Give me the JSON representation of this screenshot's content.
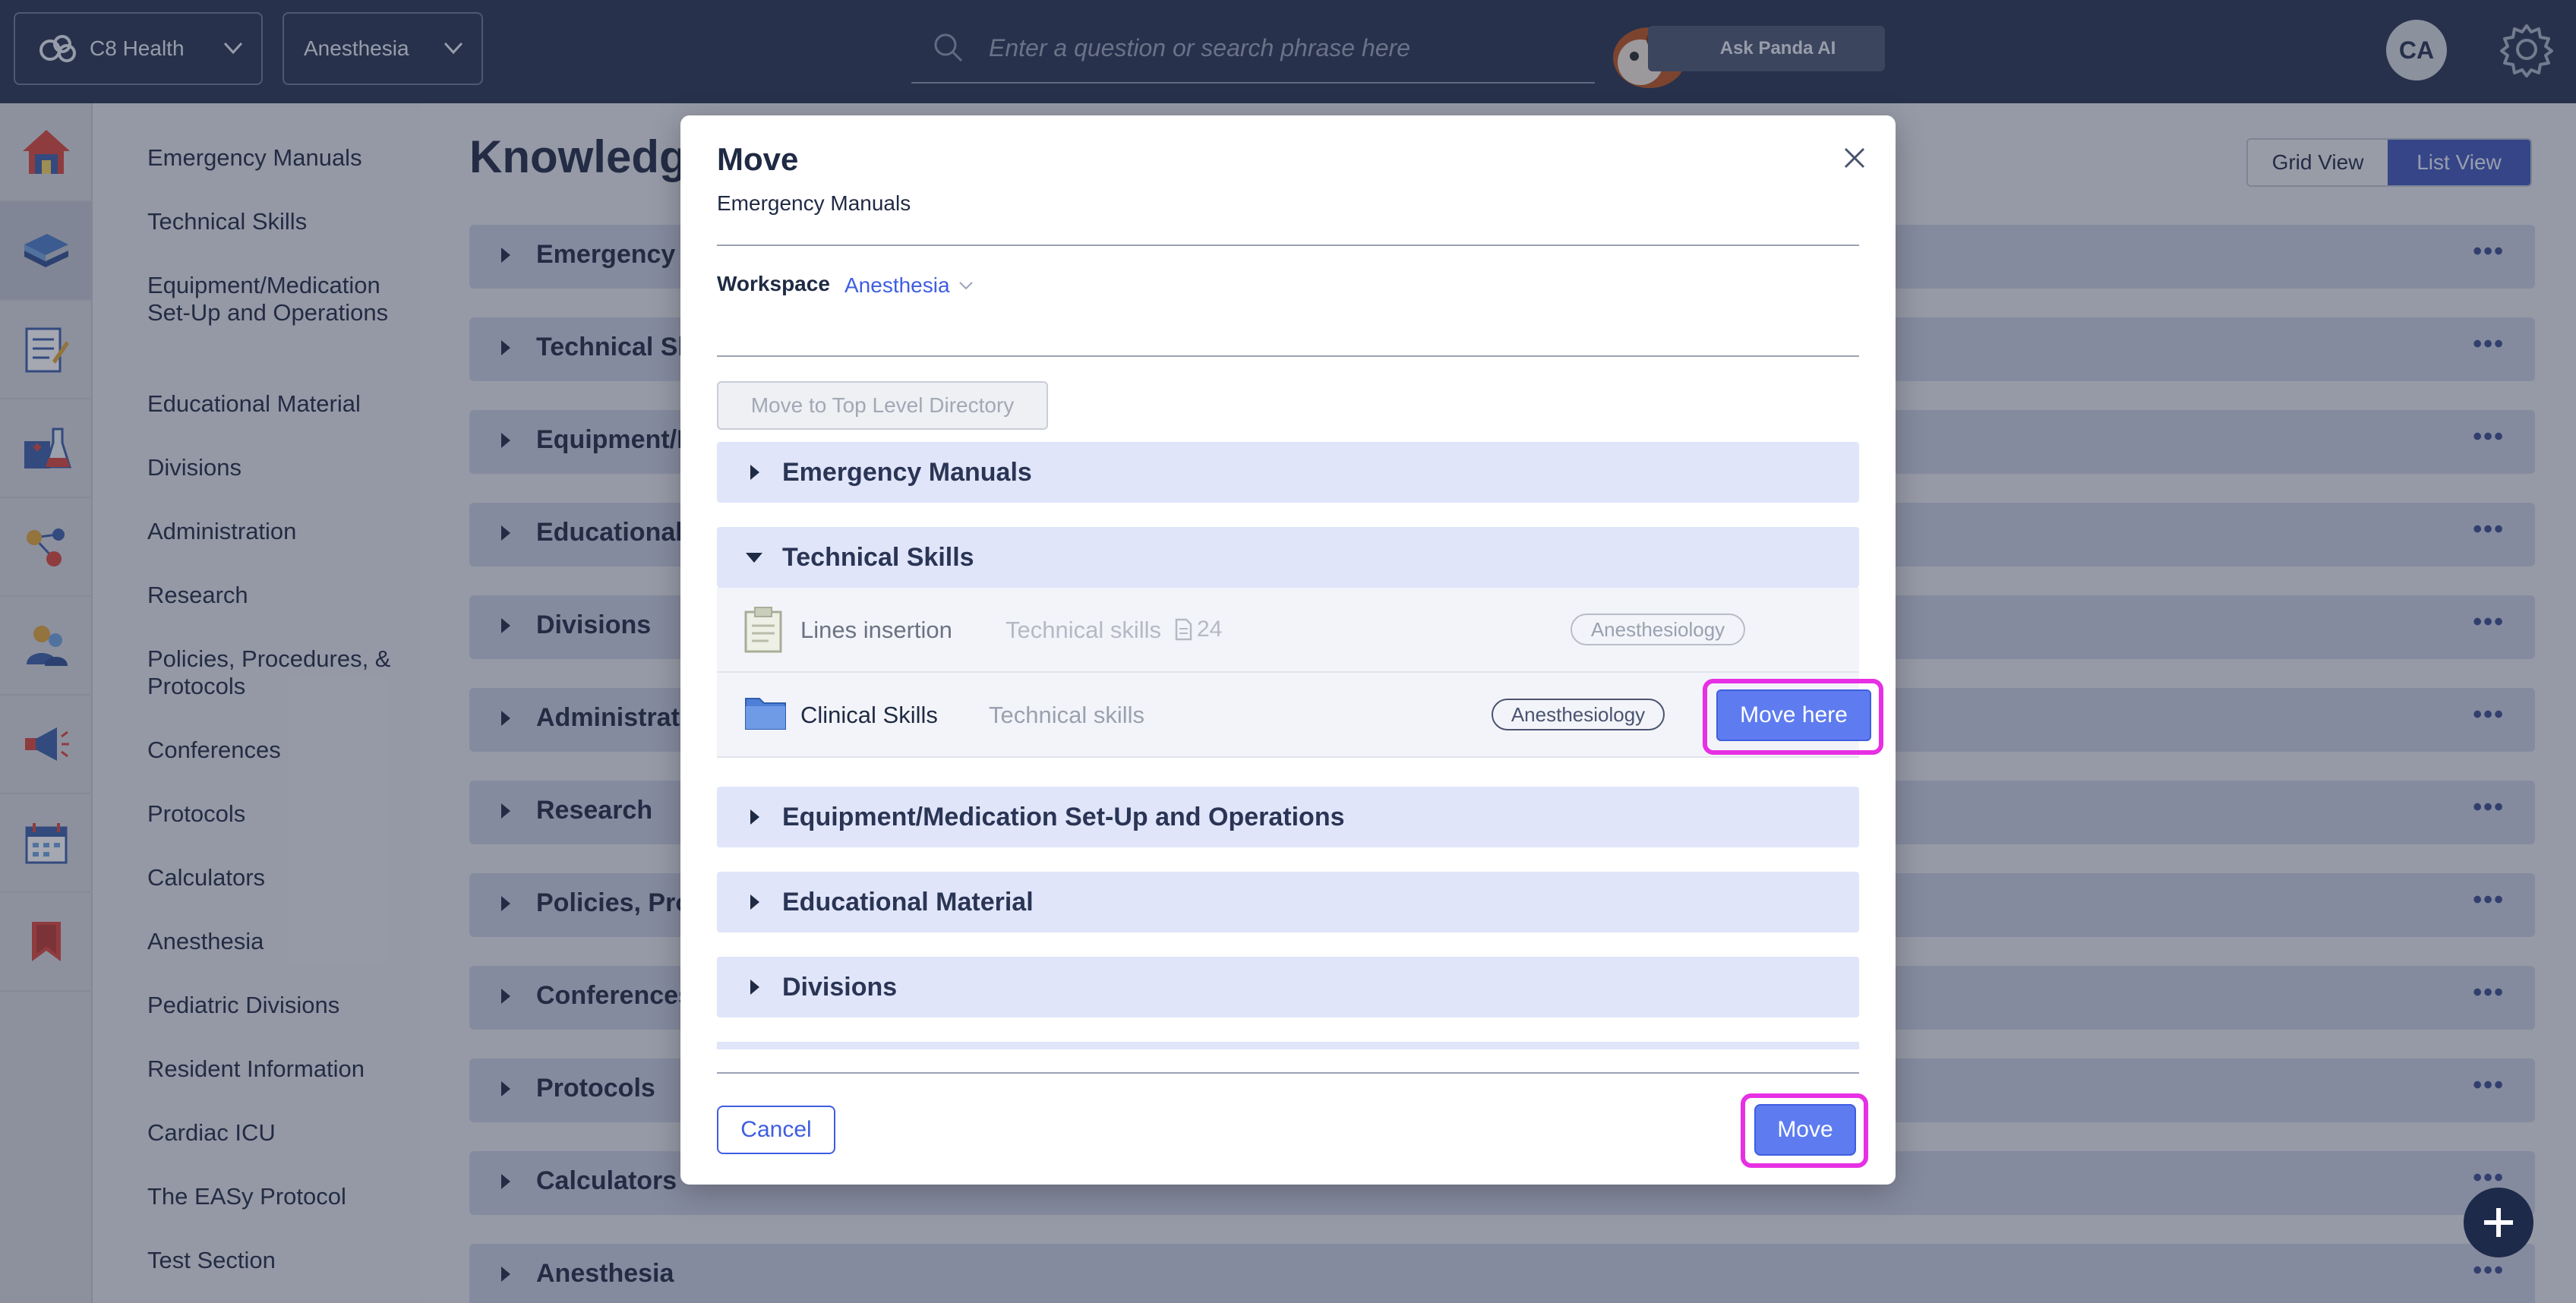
{
  "topbar": {
    "org_name": "C8 Health",
    "workspace_name": "Anesthesia",
    "search_placeholder": "Enter a question or search phrase here",
    "ask_button": "Ask Panda AI",
    "avatar_initials": "CA"
  },
  "rail": {
    "items": [
      "home-icon",
      "knowledge-books-icon",
      "checklist-icon",
      "lab-flask-icon",
      "network-icon",
      "people-icon",
      "megaphone-icon",
      "calendar-icon",
      "bookmark-icon"
    ],
    "active_index": 1
  },
  "sidebar": {
    "items": [
      "Emergency Manuals",
      "Technical Skills",
      "Equipment/Medication Set-Up and Operations",
      "Educational Material",
      "Divisions",
      "Administration",
      "Research",
      "Policies, Procedures, & Protocols",
      "Conferences",
      "Protocols",
      "Calculators",
      "Anesthesia",
      "Pediatric Divisions",
      "Resident Information",
      "Cardiac ICU",
      "The EASy Protocol",
      "Test Section"
    ]
  },
  "main": {
    "title": "Knowledge",
    "grid_view": "Grid View",
    "list_view": "List View",
    "rows": [
      "Emergency M",
      "Technical Sk",
      "Equipment/M",
      "Educational",
      "Divisions",
      "Administratio",
      "Research",
      "Policies, Pro",
      "Conferences",
      "Protocols",
      "Calculators",
      "Anesthesia"
    ],
    "more_glyph": "•••"
  },
  "modal": {
    "title": "Move",
    "subtitle": "Emergency Manuals",
    "workspace_label": "Workspace",
    "workspace_value": "Anesthesia",
    "top_level_button": "Move to Top Level Directory",
    "folders": [
      {
        "label": "Emergency Manuals",
        "expanded": false
      },
      {
        "label": "Technical Skills",
        "expanded": true
      },
      {
        "label": "Equipment/Medication Set-Up and Operations",
        "expanded": false
      },
      {
        "label": "Educational Material",
        "expanded": false
      },
      {
        "label": "Divisions",
        "expanded": false
      }
    ],
    "children": [
      {
        "name": "Lines insertion",
        "path": "Technical skills",
        "count": "24",
        "tag": "Anesthesiology",
        "icon": "clipboard-doc-icon"
      },
      {
        "name": "Clinical Skills",
        "path": "Technical skills",
        "tag": "Anesthesiology",
        "icon": "folder-icon",
        "action": "Move here"
      }
    ],
    "cancel": "Cancel",
    "move": "Move"
  },
  "colors": {
    "topbar": "#263250",
    "accent": "#3e5ee0",
    "button_fill": "#5e7cf0",
    "highlight_ring": "#e72fe3",
    "folder_row": "#e0e5f9"
  }
}
